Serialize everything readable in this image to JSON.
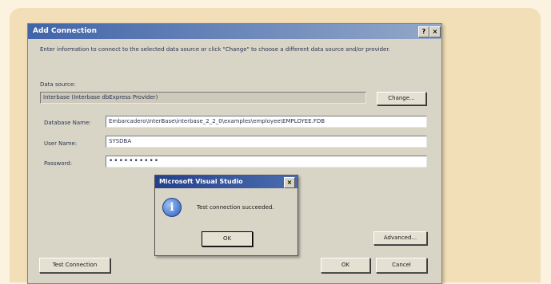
{
  "dialog": {
    "title": "Add Connection",
    "help_button": "?",
    "close_button": "×",
    "instructions": "Enter information to connect to the selected data source or click \"Change\" to choose a different data source and/or provider.",
    "data_source_label": "Data source:",
    "data_source_value": "Interbase (Interbase dbExpress Provider)",
    "change_button": "Change...",
    "database_name_label": "Database Name:",
    "database_name_value": "Embarcadero\\InterBase\\interbase_2_2_0\\examples\\employee\\EMPLOYEE.FDB",
    "user_name_label": "User Name:",
    "user_name_value": "SYSDBA",
    "password_label": "Password:",
    "password_value": "••••••••••",
    "advanced_button": "Advanced...",
    "test_connection_button": "Test Connection",
    "ok_button": "OK",
    "cancel_button": "Cancel"
  },
  "message_box": {
    "title": "Microsoft Visual Studio",
    "close_button": "×",
    "icon": "info-icon",
    "message": "Test connection succeeded.",
    "ok_button": "OK"
  },
  "colors": {
    "background": "#fbf2e0",
    "frame": "#f2dfb8",
    "dialog_face": "#d8d4c6",
    "title_gradient_start": "#3a5fa8",
    "message_title": "#23418c"
  }
}
